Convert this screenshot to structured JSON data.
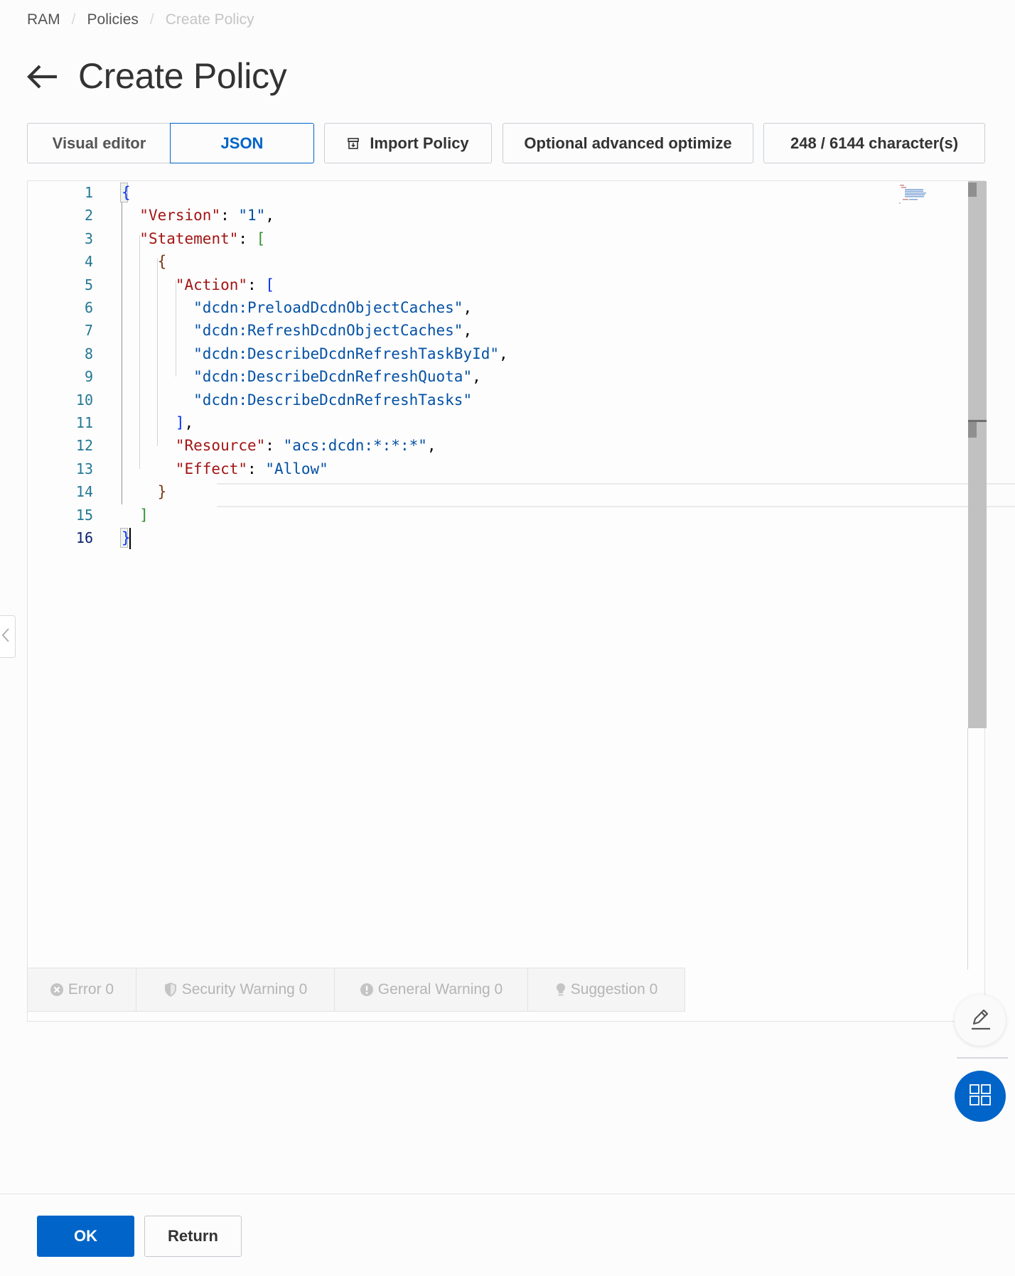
{
  "breadcrumb": {
    "items": [
      "RAM",
      "Policies",
      "Create Policy"
    ],
    "separator": "/"
  },
  "header": {
    "title": "Create Policy",
    "back_icon": "arrow-left-icon"
  },
  "toolbar": {
    "tabs": [
      {
        "label": "Visual editor",
        "active": false
      },
      {
        "label": "JSON",
        "active": true
      }
    ],
    "import_label": "Import Policy",
    "import_icon": "import-box-icon",
    "optimize_label": "Optional advanced optimize",
    "char_count_label": "248 / 6144 character(s)"
  },
  "editor": {
    "line_numbers": [
      "1",
      "2",
      "3",
      "4",
      "5",
      "6",
      "7",
      "8",
      "9",
      "10",
      "11",
      "12",
      "13",
      "14",
      "15",
      "16"
    ],
    "active_line": 16,
    "lines": [
      [
        {
          "t": "{",
          "c": "b1"
        }
      ],
      [
        {
          "t": "  "
        },
        {
          "t": "\"Version\"",
          "c": "k"
        },
        {
          "t": ": "
        },
        {
          "t": "\"1\"",
          "c": "s"
        },
        {
          "t": ","
        }
      ],
      [
        {
          "t": "  "
        },
        {
          "t": "\"Statement\"",
          "c": "k"
        },
        {
          "t": ": "
        },
        {
          "t": "[",
          "c": "b2"
        }
      ],
      [
        {
          "t": "    "
        },
        {
          "t": "{",
          "c": "b3"
        }
      ],
      [
        {
          "t": "      "
        },
        {
          "t": "\"Action\"",
          "c": "k"
        },
        {
          "t": ": "
        },
        {
          "t": "[",
          "c": "b1"
        }
      ],
      [
        {
          "t": "        "
        },
        {
          "t": "\"dcdn:PreloadDcdnObjectCaches\"",
          "c": "s"
        },
        {
          "t": ","
        }
      ],
      [
        {
          "t": "        "
        },
        {
          "t": "\"dcdn:RefreshDcdnObjectCaches\"",
          "c": "s"
        },
        {
          "t": ","
        }
      ],
      [
        {
          "t": "        "
        },
        {
          "t": "\"dcdn:DescribeDcdnRefreshTaskById\"",
          "c": "s"
        },
        {
          "t": ","
        }
      ],
      [
        {
          "t": "        "
        },
        {
          "t": "\"dcdn:DescribeDcdnRefreshQuota\"",
          "c": "s"
        },
        {
          "t": ","
        }
      ],
      [
        {
          "t": "        "
        },
        {
          "t": "\"dcdn:DescribeDcdnRefreshTasks\"",
          "c": "s"
        }
      ],
      [
        {
          "t": "      "
        },
        {
          "t": "]",
          "c": "b1"
        },
        {
          "t": ","
        }
      ],
      [
        {
          "t": "      "
        },
        {
          "t": "\"Resource\"",
          "c": "k"
        },
        {
          "t": ": "
        },
        {
          "t": "\"acs:dcdn:*:*:*\"",
          "c": "s"
        },
        {
          "t": ","
        }
      ],
      [
        {
          "t": "      "
        },
        {
          "t": "\"Effect\"",
          "c": "k"
        },
        {
          "t": ": "
        },
        {
          "t": "\"Allow\"",
          "c": "s"
        }
      ],
      [
        {
          "t": "    "
        },
        {
          "t": "}",
          "c": "b3"
        }
      ],
      [
        {
          "t": "  "
        },
        {
          "t": "]",
          "c": "b2"
        }
      ],
      [
        {
          "t": "}",
          "c": "b1"
        }
      ]
    ]
  },
  "status_bar": {
    "tabs": [
      {
        "label": "Error 0",
        "icon": "error-circle-icon"
      },
      {
        "label": "Security Warning 0",
        "icon": "shield-icon"
      },
      {
        "label": "General Warning 0",
        "icon": "exclamation-circle-icon"
      },
      {
        "label": "Suggestion 0",
        "icon": "lightbulb-icon"
      }
    ]
  },
  "floating": {
    "edit_icon": "pencil-icon",
    "apps_icon": "grid-icon"
  },
  "footer": {
    "ok_label": "OK",
    "return_label": "Return"
  },
  "colors": {
    "accent": "#0064c8",
    "json_key": "#a31515",
    "json_string": "#0451a5",
    "line_number": "#237893"
  }
}
